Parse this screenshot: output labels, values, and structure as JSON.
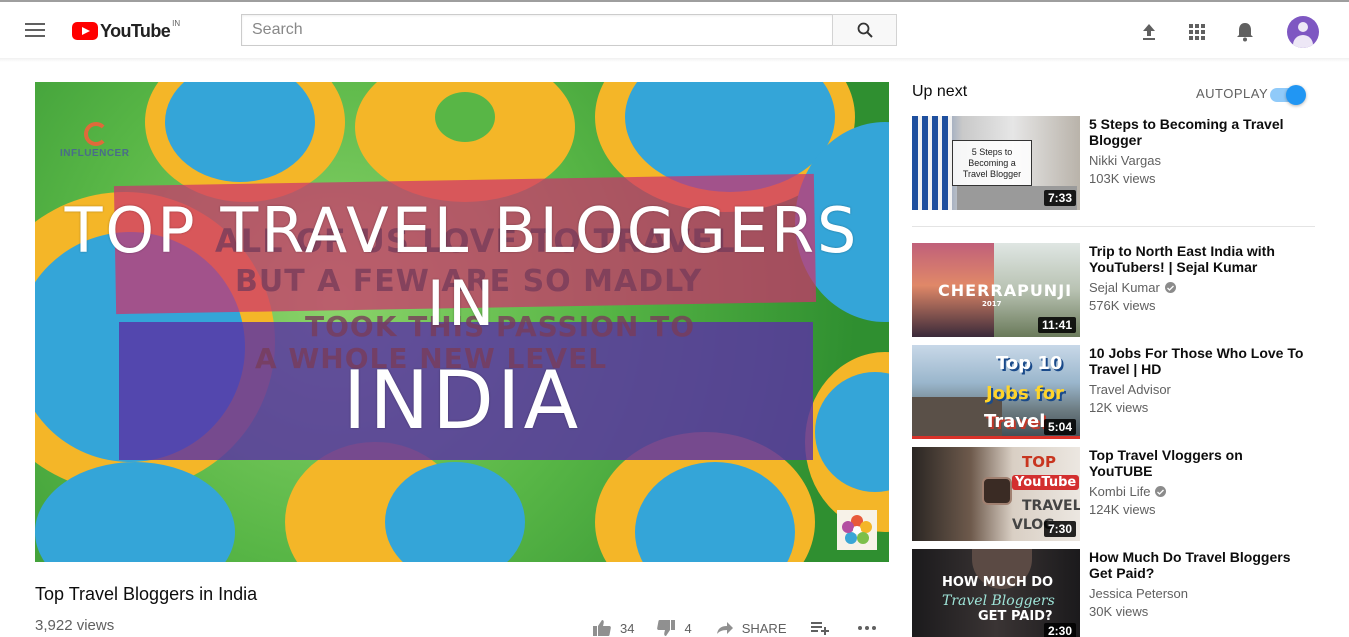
{
  "brand": {
    "name": "YouTube",
    "region": "IN"
  },
  "search": {
    "placeholder": "Search"
  },
  "icons": {
    "menu": "hamburger-menu-icon",
    "search": "magnifier-icon",
    "upload": "upload-icon",
    "apps": "apps-grid-icon",
    "notifications": "bell-icon",
    "account": "avatar-icon"
  },
  "player": {
    "thumbnail_title_line1": "TOP TRAVEL BLOGGERS IN",
    "thumbnail_title_line2": "INDIA",
    "thumbnail_overlay_line1": "ALL OF US LOVE TO TRAVEL",
    "thumbnail_overlay_line2": "BUT A FEW ARE SO MADLY",
    "thumbnail_overlay_line3": "TOOK THIS PASSION TO",
    "thumbnail_overlay_line4": "A WHOLE NEW LEVEL",
    "watermark_text": "INFLUENCER"
  },
  "video": {
    "title": "Top Travel Bloggers in India",
    "views": "3,922 views",
    "likes": "34",
    "dislikes": "4",
    "share_label": "SHARE"
  },
  "sidebar": {
    "up_next": "Up next",
    "autoplay_label": "AUTOPLAY",
    "autoplay_on": true,
    "recommendations": [
      {
        "title": "5 Steps to Becoming a Travel Blogger",
        "channel": "Nikki Vargas",
        "verified": false,
        "views": "103K views",
        "duration": "7:33",
        "thumb_text": "5 Steps to Becoming a Travel Blogger"
      },
      {
        "title": "Trip to North East India with YouTubers! | Sejal Kumar",
        "channel": "Sejal Kumar",
        "verified": true,
        "views": "576K views",
        "duration": "11:41",
        "thumb_text": "CHERRAPUNJI",
        "thumb_subtext": "2017"
      },
      {
        "title": "10 Jobs For Those Who Love To Travel | HD",
        "channel": "Travel Advisor",
        "verified": false,
        "views": "12K views",
        "duration": "5:04",
        "thumb_text_1": "Top 10",
        "thumb_text_2": "Jobs for",
        "thumb_text_3": "Travel"
      },
      {
        "title": "Top Travel Vloggers on YouTUBE",
        "channel": "Kombi Life",
        "verified": true,
        "views": "124K views",
        "duration": "7:30",
        "thumb_text_1": "TOP",
        "thumb_text_2": "YouTube",
        "thumb_text_3": "TRAVEL",
        "thumb_text_4": "VLOG"
      },
      {
        "title": "How Much Do Travel Bloggers Get Paid?",
        "channel": "Jessica Peterson",
        "verified": false,
        "views": "30K views",
        "duration": "2:30",
        "thumb_text_1": "HOW MUCH DO",
        "thumb_text_2": "Travel Bloggers",
        "thumb_text_3": "GET PAID?"
      }
    ]
  },
  "colors": {
    "brand_red": "#ff0000",
    "autoplay_blue": "#2196f3",
    "text_secondary": "#606060"
  }
}
